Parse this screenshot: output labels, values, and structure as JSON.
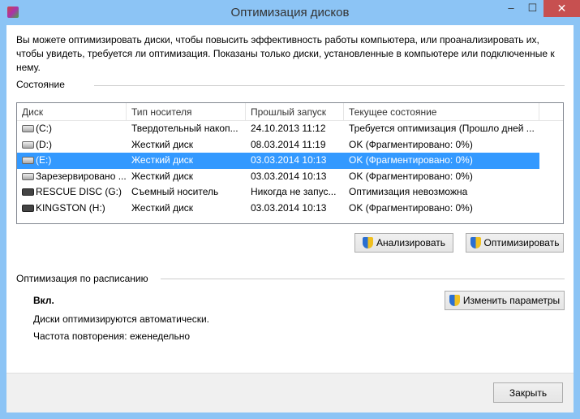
{
  "window": {
    "title": "Оптимизация дисков",
    "minimize": "‒",
    "maximize": "☐",
    "close": "✕"
  },
  "description": "Вы можете оптимизировать диски, чтобы повысить эффективность работы  компьютера, или проанализировать их, чтобы увидеть, требуется ли оптимизация. Показаны только диски, установленные в компьютере или подключенные к нему.",
  "status_section": "Состояние",
  "columns": [
    "Диск",
    "Тип носителя",
    "Прошлый запуск",
    "Текущее состояние"
  ],
  "drives": [
    {
      "name": "(C:)",
      "type": "Твердотельный накоп...",
      "last": "24.10.2013 11:12",
      "state": "Требуется оптимизация (Прошло дней ..."
    },
    {
      "name": "(D:)",
      "type": "Жесткий диск",
      "last": "08.03.2014 11:19",
      "state": "OK (Фрагментировано: 0%)"
    },
    {
      "name": "(E:)",
      "type": "Жесткий диск",
      "last": "03.03.2014 10:13",
      "state": "OK (Фрагментировано: 0%)"
    },
    {
      "name": "Зарезервировано ...",
      "type": "Жесткий диск",
      "last": "03.03.2014 10:13",
      "state": "OK (Фрагментировано: 0%)"
    },
    {
      "name": "RESCUE DISC (G:)",
      "type": "Съемный носитель",
      "last": "Никогда не запус...",
      "state": "Оптимизация невозможна"
    },
    {
      "name": "KINGSTON (H:)",
      "type": "Жесткий диск",
      "last": "03.03.2014 10:13",
      "state": "OK (Фрагментировано: 0%)"
    }
  ],
  "buttons": {
    "analyze": "Анализировать",
    "optimize": "Оптимизировать",
    "change": "Изменить параметры",
    "close": "Закрыть"
  },
  "schedule": {
    "title": "Оптимизация по расписанию",
    "state": "Вкл.",
    "auto": "Диски оптимизируются автоматически.",
    "frequency": "Частота повторения: еженедельно"
  }
}
